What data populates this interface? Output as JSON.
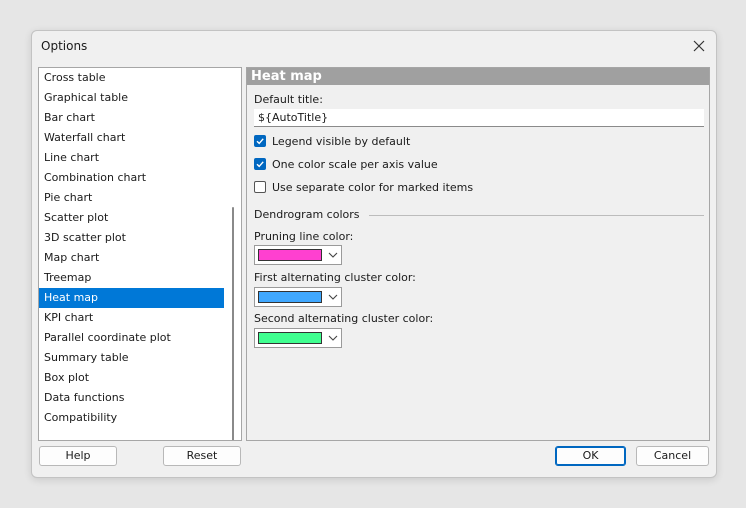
{
  "window": {
    "title": "Options"
  },
  "sidebar": {
    "items": [
      {
        "label": "Cross table"
      },
      {
        "label": "Graphical table"
      },
      {
        "label": "Bar chart"
      },
      {
        "label": "Waterfall chart"
      },
      {
        "label": "Line chart"
      },
      {
        "label": "Combination chart"
      },
      {
        "label": "Pie chart"
      },
      {
        "label": "Scatter plot"
      },
      {
        "label": "3D scatter plot"
      },
      {
        "label": "Map chart"
      },
      {
        "label": "Treemap"
      },
      {
        "label": "Heat map",
        "selected": true
      },
      {
        "label": "KPI chart"
      },
      {
        "label": "Parallel coordinate plot"
      },
      {
        "label": "Summary table"
      },
      {
        "label": "Box plot"
      },
      {
        "label": "Data functions"
      },
      {
        "label": "Compatibility"
      }
    ]
  },
  "panel": {
    "header": "Heat map",
    "default_title_label": "Default title:",
    "default_title_value": "${AutoTitle}",
    "checkboxes": [
      {
        "label": "Legend visible by default",
        "checked": true
      },
      {
        "label": "One color scale per axis value",
        "checked": true
      },
      {
        "label": "Use separate color for marked items",
        "checked": false
      }
    ],
    "section_label": "Dendrogram colors",
    "colors": [
      {
        "label": "Pruning line color:",
        "color": "#ff40d0"
      },
      {
        "label": "First alternating cluster color:",
        "color": "#40a8ff"
      },
      {
        "label": "Second alternating cluster color:",
        "color": "#40ff90"
      }
    ]
  },
  "buttons": {
    "help": "Help",
    "reset": "Reset",
    "ok": "OK",
    "cancel": "Cancel"
  },
  "icons": {
    "close": "close-icon",
    "check": "checkmark-icon",
    "dropdown": "chevron-down-icon"
  }
}
